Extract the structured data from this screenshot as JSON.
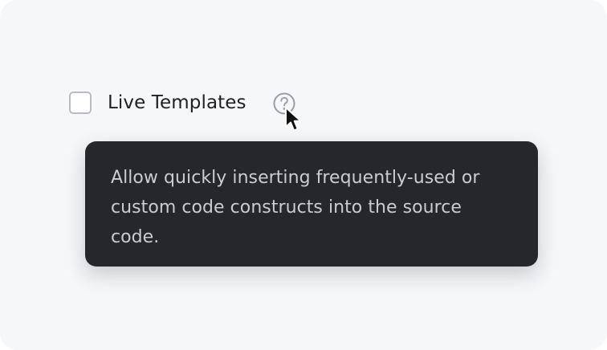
{
  "setting": {
    "label": "Live Templates",
    "checked": false,
    "help_icon": "question-circle-icon"
  },
  "tooltip": {
    "text": "Allow quickly inserting frequently-used or custom code constructs into the source code."
  },
  "cursor": {
    "icon": "arrow-pointer-icon"
  },
  "colors": {
    "background": "#f6f7f9",
    "tooltip_background": "#26272b",
    "tooltip_text": "#c9ccd3",
    "label_text": "#1f2024",
    "checkbox_border": "#b9bcc3",
    "help_icon": "#9a9da5"
  }
}
